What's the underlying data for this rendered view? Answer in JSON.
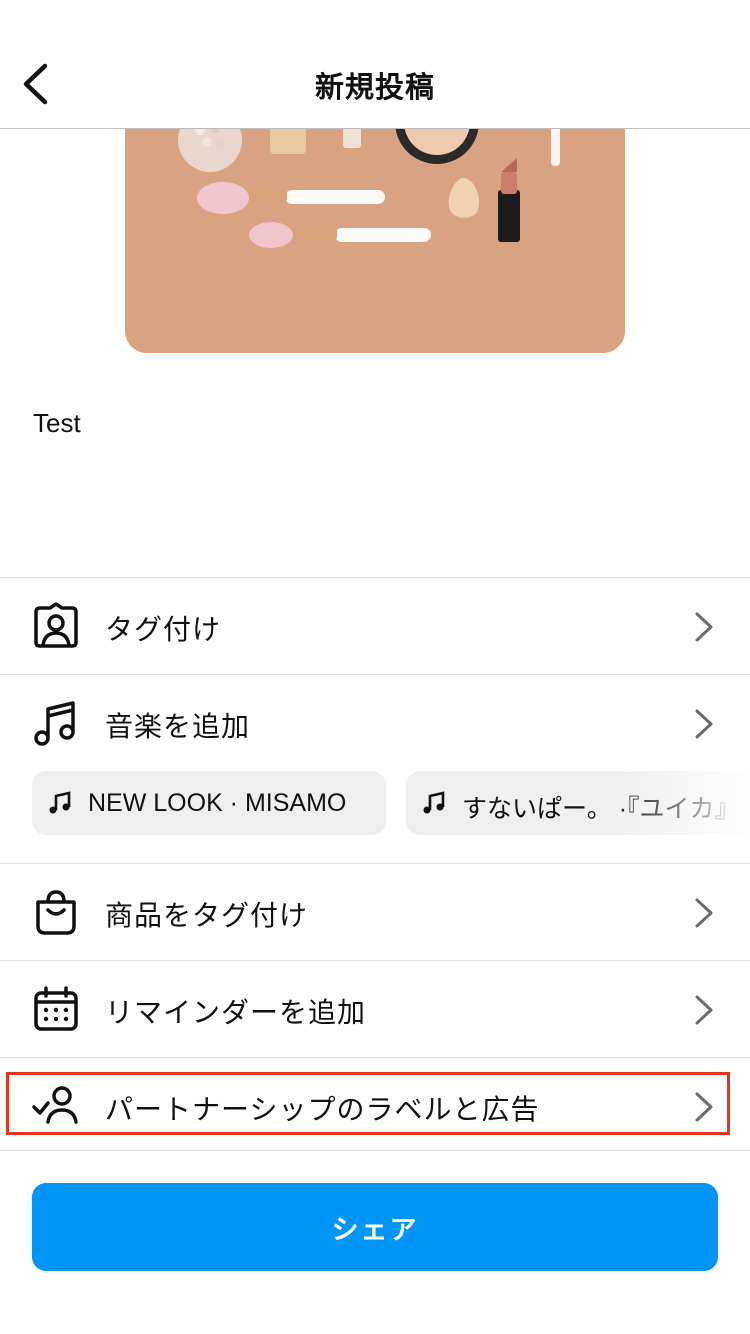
{
  "header": {
    "title": "新規投稿"
  },
  "caption": {
    "text": "Test"
  },
  "options": {
    "tag_people": "タグ付け",
    "add_music": "音楽を追加",
    "tag_products": "商品をタグ付け",
    "add_reminder": "リマインダーを追加",
    "partnership": "パートナーシップのラベルと広告"
  },
  "music_suggestions": [
    {
      "title": "NEW LOOK · MISAMO"
    },
    {
      "title": "すないぱー。 ·『ユイカ』"
    }
  ],
  "share": {
    "label": "シェア"
  },
  "colors": {
    "accent": "#0095f6",
    "highlight": "#e8341c",
    "image_background": "#d9a381"
  },
  "icons": {
    "back": "chevron-left-icon",
    "tag_people": "person-tag-icon",
    "music": "music-note-icon",
    "shopping": "shopping-bag-icon",
    "calendar": "calendar-icon",
    "partnership": "person-check-icon",
    "row_chevron": "chevron-right-icon"
  }
}
